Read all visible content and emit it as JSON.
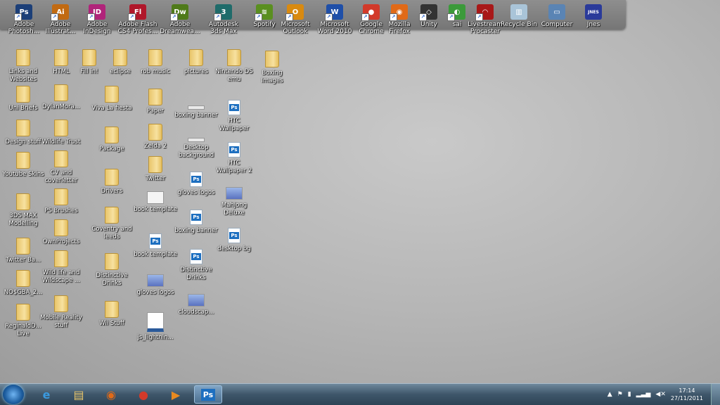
{
  "dock": [
    {
      "label": "Adobe Photosh...",
      "name": "photoshop",
      "bg": "#1c3f78",
      "glyph": "Ps"
    },
    {
      "label": "Adobe Illustrat...",
      "name": "illustrator",
      "bg": "#c16a12",
      "glyph": "Ai"
    },
    {
      "label": "Adobe InDesign CS4",
      "name": "indesign",
      "bg": "#b0247a",
      "glyph": "ID"
    },
    {
      "label": "Adobe Flash CS4 Profes...",
      "name": "flash",
      "bg": "#b0172a",
      "glyph": "Fl"
    },
    {
      "label": "Adobe Dreamwea...",
      "name": "dreamweaver",
      "bg": "#4f7a1a",
      "glyph": "Dw"
    },
    {
      "label": "Autodesk 3ds Max 2009 3...",
      "name": "3dsmax",
      "bg": "#1f6b6a",
      "glyph": "3"
    },
    {
      "label": "Spotify",
      "name": "spotify",
      "bg": "#5a8f1f",
      "glyph": "≋"
    },
    {
      "label": "Microsoft Outlook 2010",
      "name": "outlook",
      "bg": "#d98a10",
      "glyph": "O"
    },
    {
      "label": "Microsoft Word 2010",
      "name": "word",
      "bg": "#1f4fa8",
      "glyph": "W"
    },
    {
      "label": "Google Chrome",
      "name": "chrome",
      "bg": "#d23a2a",
      "glyph": "●"
    },
    {
      "label": "Mozilla Firefox",
      "name": "firefox",
      "bg": "#e06a18",
      "glyph": "◉"
    },
    {
      "label": "Unity",
      "name": "unity",
      "bg": "#333333",
      "glyph": "◇"
    },
    {
      "label": "sai",
      "name": "sai",
      "bg": "#3b9a3a",
      "glyph": "◐"
    },
    {
      "label": "Livestream Procaster",
      "name": "procaster",
      "bg": "#a81818",
      "glyph": "◠"
    },
    {
      "label": "Recycle Bin",
      "name": "recycle-bin",
      "bg": "#a9c4d8",
      "glyph": "▥"
    },
    {
      "label": "Computer",
      "name": "computer",
      "bg": "#5a84b4",
      "glyph": "▭"
    },
    {
      "label": "Jnes",
      "name": "jnes",
      "bg": "#2a3a9a",
      "glyph": "JNES"
    }
  ],
  "icons": [
    {
      "label": "Links and Websites",
      "kind": "folder",
      "name": "links-and-websites"
    },
    {
      "label": "Uni Briefs",
      "kind": "folder",
      "name": "uni-briefs"
    },
    {
      "label": "Design stuff",
      "kind": "folder",
      "name": "design-stuff"
    },
    {
      "label": "Youtube Skins",
      "kind": "folder",
      "name": "youtube-skins"
    },
    {
      "label": "3DS MAX Modelling",
      "kind": "folder",
      "name": "3ds-max-modelling"
    },
    {
      "label": "Twitter Ba...",
      "kind": "folder",
      "name": "twitter-ba"
    },
    {
      "label": "NO$GBA_2...",
      "kind": "folder",
      "name": "nogba"
    },
    {
      "label": "ReginaldD... Live",
      "kind": "folder",
      "name": "reginald-live"
    },
    {
      "label": "HTML",
      "kind": "folder",
      "name": "html"
    },
    {
      "label": "DylanMora...",
      "kind": "folder",
      "name": "dylan-mora"
    },
    {
      "label": "Wildlife Trust",
      "kind": "folder",
      "name": "wildlife-trust"
    },
    {
      "label": "CV and coverletter",
      "kind": "folder",
      "name": "cv-and-coverletter"
    },
    {
      "label": "PS Brushes",
      "kind": "folder",
      "name": "ps-brushes"
    },
    {
      "label": "OwnProjects",
      "kind": "folder",
      "name": "own-projects"
    },
    {
      "label": "Wild life and Wildscape ...",
      "kind": "folder",
      "name": "wildlife-and-wildscape"
    },
    {
      "label": "Mobile Reality stuff",
      "kind": "folder",
      "name": "mobile-reality-stuff"
    },
    {
      "label": "Fill in!",
      "kind": "folder",
      "name": "fill-in"
    },
    {
      "label": "eclipse",
      "kind": "folder",
      "name": "eclipse"
    },
    {
      "label": "Viva La fiesta",
      "kind": "folder",
      "name": "viva-la-fiesta"
    },
    {
      "label": "Package",
      "kind": "folder",
      "name": "package"
    },
    {
      "label": "Drivers",
      "kind": "folder",
      "name": "drivers"
    },
    {
      "label": "Coventry and leeds",
      "kind": "folder",
      "name": "coventry-and-leeds"
    },
    {
      "label": "Distinctive Drinks",
      "kind": "folder",
      "name": "distinctive-drinks-folder"
    },
    {
      "label": "Wii Stuff",
      "kind": "folder",
      "name": "wii-stuff"
    },
    {
      "label": "rob music",
      "kind": "folder",
      "name": "rob-music"
    },
    {
      "label": "Paper",
      "kind": "folder",
      "name": "paper"
    },
    {
      "label": "Zelda 2",
      "kind": "folder",
      "name": "zelda-2"
    },
    {
      "label": "Twitter",
      "kind": "folder",
      "name": "twitter"
    },
    {
      "label": "book template",
      "kind": "blank",
      "name": "book-template-image"
    },
    {
      "label": "book template",
      "kind": "ps",
      "name": "book-template-psd"
    },
    {
      "label": "gloves logos",
      "kind": "image",
      "name": "gloves-logos-image"
    },
    {
      "label": "js_lightnin...",
      "kind": "brush",
      "name": "js-lightning"
    },
    {
      "label": "pictures",
      "kind": "folder",
      "name": "pictures"
    },
    {
      "label": "boxing banner",
      "kind": "thin",
      "name": "boxing-banner-image"
    },
    {
      "label": "Desktop background",
      "kind": "thin",
      "name": "desktop-background"
    },
    {
      "label": "gloves logos",
      "kind": "ps",
      "name": "gloves-logos-psd"
    },
    {
      "label": "boxing banner",
      "kind": "ps",
      "name": "boxing-banner-psd"
    },
    {
      "label": "Distinctive Drinks",
      "kind": "ps",
      "name": "distinctive-drinks-psd"
    },
    {
      "label": "cloudscap...",
      "kind": "image",
      "name": "cloudscape"
    },
    {
      "label": "Nintendo DS emu",
      "kind": "folder",
      "name": "nintendo-ds-emu"
    },
    {
      "label": "HTC Wallpaper",
      "kind": "ps",
      "name": "htc-wallpaper"
    },
    {
      "label": "HTC Wallpaper 2",
      "kind": "ps",
      "name": "htc-wallpaper-2"
    },
    {
      "label": "Mahjong Deluxe",
      "kind": "image",
      "name": "mahjong-deluxe"
    },
    {
      "label": "desktop bg",
      "kind": "ps",
      "name": "desktop-bg"
    },
    {
      "label": "Boxing Images",
      "kind": "folder",
      "name": "boxing-images"
    }
  ],
  "taskbar": {
    "apps": [
      {
        "name": "internet-explorer",
        "glyph": "e",
        "color": "#3a9ae0"
      },
      {
        "name": "windows-explorer",
        "glyph": "▤",
        "color": "#e8c56a"
      },
      {
        "name": "firefox",
        "glyph": "◉",
        "color": "#e06a18"
      },
      {
        "name": "chrome",
        "glyph": "●",
        "color": "#d23a2a"
      },
      {
        "name": "media-player",
        "glyph": "▶",
        "color": "#e88a20"
      },
      {
        "name": "photoshop",
        "glyph": "Ps",
        "color": "#1d6fc0"
      }
    ],
    "time": "17:14",
    "date": "27/11/2011"
  }
}
